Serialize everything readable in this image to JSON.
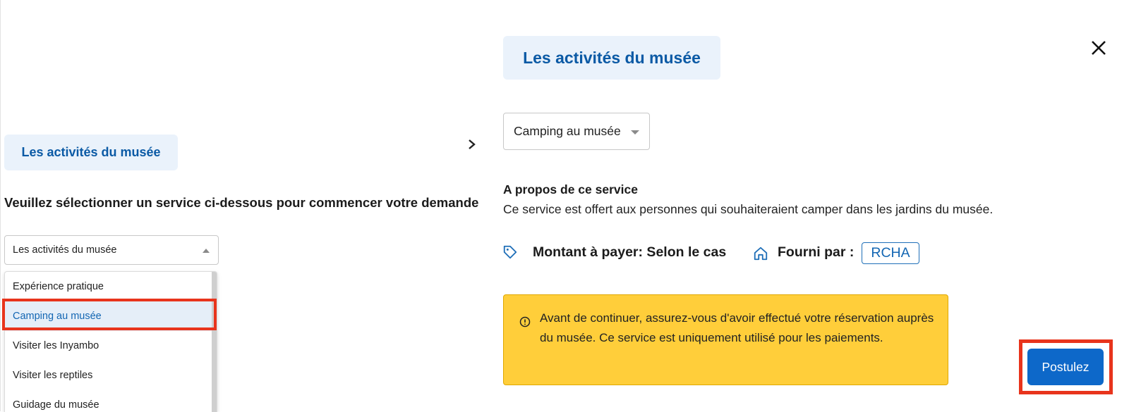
{
  "left_panel": {
    "category_pill": "Les activités du musée",
    "instruction": "Veuillez sélectionner un service ci-dessous pour commencer votre demande",
    "category_select_value": "Les activités du musée",
    "options": [
      {
        "label": "Expérience pratique",
        "selected": false
      },
      {
        "label": "Camping au musée",
        "selected": true
      },
      {
        "label": "Visiter les Inyambo",
        "selected": false
      },
      {
        "label": "Visiter les reptiles",
        "selected": false
      },
      {
        "label": "Guidage du musée",
        "selected": false
      }
    ]
  },
  "right_panel": {
    "category_pill": "Les activités du musée",
    "service_select_value": "Camping au musée",
    "about_title": "A propos de ce service",
    "about_description": "Ce service est offert aux personnes qui souhaiteraient camper dans les jardins du musée.",
    "price_text": "Montant à payer: Selon le cas",
    "provider_label": "Fourni par :",
    "provider_value": "RCHA",
    "alert_text": "Avant de continuer, assurez-vous d'avoir effectué votre réservation auprès du musée. Ce service est uniquement utilisé pour les paiements.",
    "apply_button": "Postulez"
  },
  "icons": {
    "close": "close-icon",
    "toggle": "chevron-right-icon",
    "price": "tag-icon",
    "provider": "home-icon",
    "alert": "info-circle-icon"
  },
  "colors": {
    "accent": "#0d68c9",
    "pill_bg": "#eaf2fb",
    "alert_bg": "#ffce3a",
    "highlight": "#e8341c"
  }
}
